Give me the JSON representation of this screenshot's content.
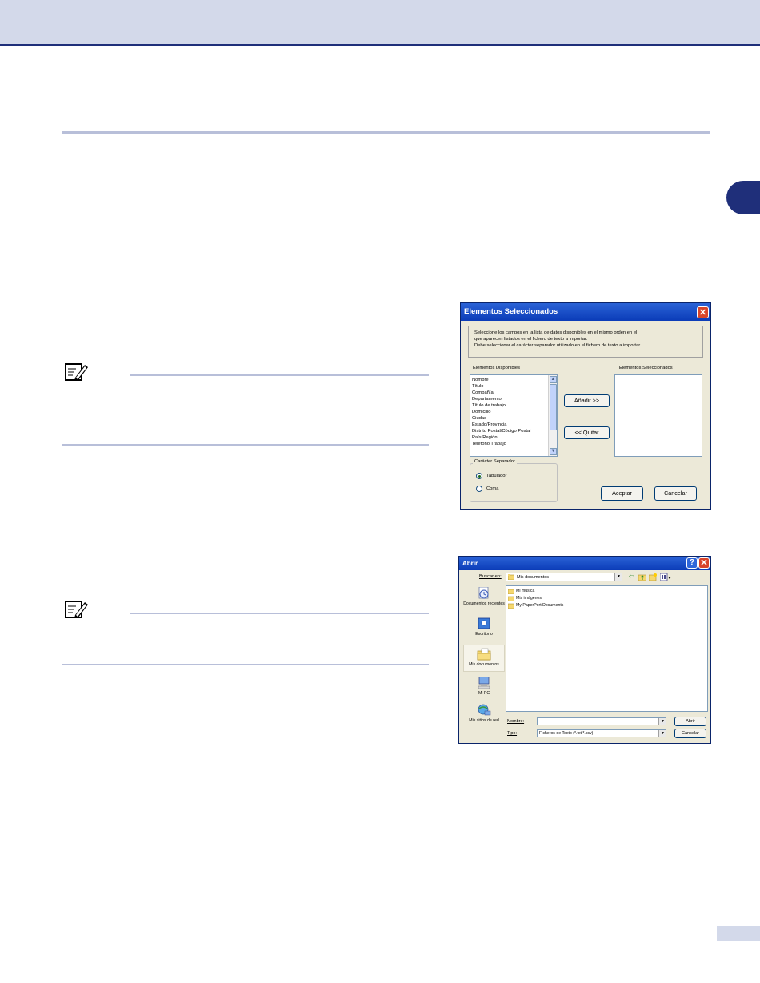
{
  "dialog_fields": {
    "title": "Elementos Seleccionados",
    "close_icon": "close-icon",
    "instructions": [
      "Seleccione los campos en la lista de datos disponibles en el mismo orden en el",
      "que aparecen listados en el fichero de texto a importar.",
      "Debe seleccionar el carácter separador utilizado en el fichero de texto a importar."
    ],
    "available_label": "Elementos Disponibles",
    "selected_label": "Elementos Seleccionados",
    "available_items": [
      "Nombre",
      "Título",
      "Compañía",
      "Departamento",
      "Título de trabajo",
      "Domicilio",
      "Ciudad",
      "Estado/Provincia",
      "Distrito Postal/Código Postal",
      "País/Región",
      "Teléfono Trabajo"
    ],
    "add_button": "Añadir >>",
    "remove_button": "<< Quitar",
    "separator_group": "Carácter Separador",
    "separator_options": [
      "Tabulador",
      "Coma"
    ],
    "separator_selected": "Tabulador",
    "ok_button": "Aceptar",
    "cancel_button": "Cancelar"
  },
  "dialog_open": {
    "title": "Abrir",
    "help_icon": "help-icon",
    "close_icon": "close-icon",
    "look_in_label": "Buscar en:",
    "look_in_value": "Mis documentos",
    "toolbar_icons": [
      "back-icon",
      "up-folder-icon",
      "new-folder-icon",
      "views-menu-icon"
    ],
    "places": [
      {
        "label": "Documentos recientes",
        "icon": "recent-documents-icon"
      },
      {
        "label": "Escritorio",
        "icon": "desktop-icon"
      },
      {
        "label": "Mis documentos",
        "icon": "my-documents-icon"
      },
      {
        "label": "Mi PC",
        "icon": "my-computer-icon"
      },
      {
        "label": "Mis sitios de red",
        "icon": "network-places-icon"
      }
    ],
    "files": [
      "Mi música",
      "Mis imágenes",
      "My PaperPort Documents"
    ],
    "name_label": "Nombre:",
    "name_value": "",
    "type_label": "Tipo:",
    "type_value": "Ficheros de Texto (*.txt;*.csv)",
    "open_button": "Abrir",
    "cancel_button": "Cancelar"
  },
  "note_icons": [
    "note-pencil-icon",
    "note-pencil-icon"
  ],
  "colors": {
    "header_band": "#d3d9ea",
    "accent_navy": "#1f2f7a",
    "rule": "#b8bfd9",
    "xp_title_blue": "#0b3cb8",
    "dialog_face": "#ece9d8"
  }
}
